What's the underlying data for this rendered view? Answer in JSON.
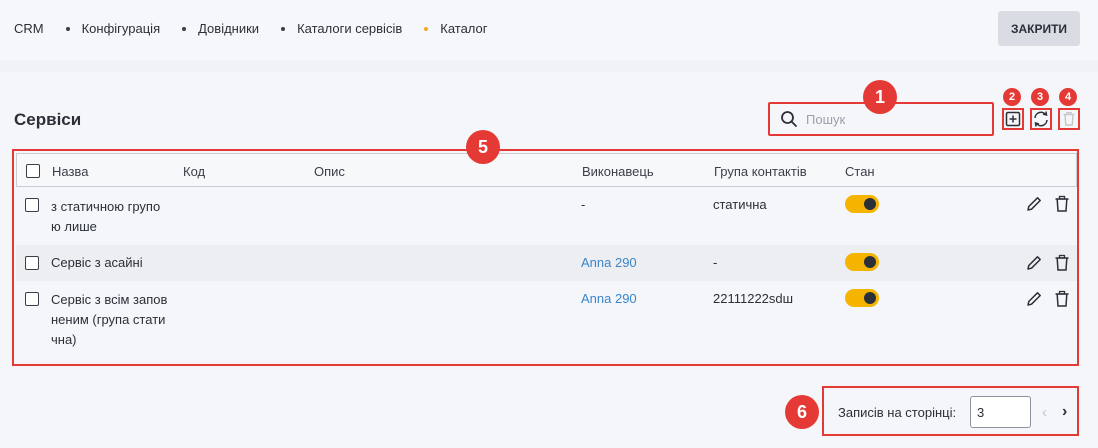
{
  "breadcrumb": {
    "root": "CRM",
    "items": [
      "Конфігурація",
      "Довідники",
      "Каталоги сервісів",
      "Каталог"
    ]
  },
  "header": {
    "close_label": "ЗАКРИТИ"
  },
  "section": {
    "title": "Сервіси"
  },
  "search": {
    "placeholder": "Пошук"
  },
  "annotations": [
    "1",
    "2",
    "3",
    "4",
    "5",
    "6"
  ],
  "table": {
    "columns": [
      "Назва",
      "Код",
      "Опис",
      "Виконавець",
      "Група контактів",
      "Стан"
    ],
    "rows": [
      {
        "name": [
          "з статичною групо",
          "ю лише"
        ],
        "code": "",
        "description": "",
        "executor": "-",
        "contact_group": "статична",
        "enabled": true
      },
      {
        "name": [
          "Сервіс з асайні"
        ],
        "code": "",
        "description": "",
        "executor": "Anna 290",
        "contact_group": "-",
        "enabled": true
      },
      {
        "name": [
          "Сервіс з всім запов",
          "неним (група стати",
          "чна)"
        ],
        "code": "",
        "description": "",
        "executor": "Anna 290",
        "contact_group": "22111222sdш",
        "enabled": true
      }
    ]
  },
  "pager": {
    "label": "Записів на сторінці:",
    "value": "3",
    "prev": "‹",
    "next": "›"
  },
  "colors": {
    "accent": "#f5b400",
    "annotation": "#e53935",
    "link": "#3a86c8"
  }
}
